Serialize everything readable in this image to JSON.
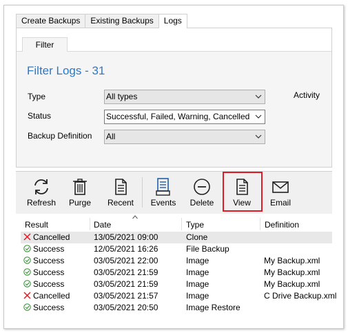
{
  "tabs": [
    {
      "label": "Create Backups"
    },
    {
      "label": "Existing Backups"
    },
    {
      "label": "Logs"
    }
  ],
  "subtab": {
    "label": "Filter"
  },
  "filter": {
    "title": "Filter Logs - 31",
    "activity_label": "Activity",
    "type_label": "Type",
    "type_value": "All types",
    "status_label": "Status",
    "status_value": "Successful, Failed, Warning, Cancelled",
    "definition_label": "Backup Definition",
    "definition_value": "All"
  },
  "toolbar": {
    "items": [
      {
        "label": "Refresh",
        "icon": "refresh-icon"
      },
      {
        "label": "Purge",
        "icon": "trash-icon"
      },
      {
        "label": "Recent",
        "icon": "document-icon"
      },
      {
        "label": "Events",
        "icon": "events-icon"
      },
      {
        "label": "Delete",
        "icon": "minus-circle-icon"
      },
      {
        "label": "View",
        "icon": "document-icon"
      },
      {
        "label": "Email",
        "icon": "envelope-icon"
      }
    ],
    "highlighted": "View",
    "highlight_color": "#e01b24"
  },
  "table": {
    "columns": [
      "Result",
      "Date",
      "Type",
      "Definition"
    ],
    "sorted_column": "Date",
    "rows": [
      {
        "result": "Cancelled",
        "status": "cancelled",
        "date": "13/05/2021 09:00",
        "type": "Clone",
        "definition": ""
      },
      {
        "result": "Success",
        "status": "success",
        "date": "12/05/2021 16:26",
        "type": "File Backup",
        "definition": ""
      },
      {
        "result": "Success",
        "status": "success",
        "date": "03/05/2021 22:00",
        "type": "Image",
        "definition": "My Backup.xml"
      },
      {
        "result": "Success",
        "status": "success",
        "date": "03/05/2021 21:59",
        "type": "Image",
        "definition": "My Backup.xml"
      },
      {
        "result": "Success",
        "status": "success",
        "date": "03/05/2021 21:59",
        "type": "Image",
        "definition": "My Backup.xml"
      },
      {
        "result": "Cancelled",
        "status": "cancelled",
        "date": "03/05/2021 21:57",
        "type": "Image",
        "definition": "C Drive Backup.xml"
      },
      {
        "result": "Success",
        "status": "success",
        "date": "03/05/2021 20:50",
        "type": "Image Restore",
        "definition": ""
      }
    ]
  },
  "colors": {
    "title": "#2b79c9",
    "cancelled": "#e01b24",
    "success": "#3c9a3c"
  }
}
